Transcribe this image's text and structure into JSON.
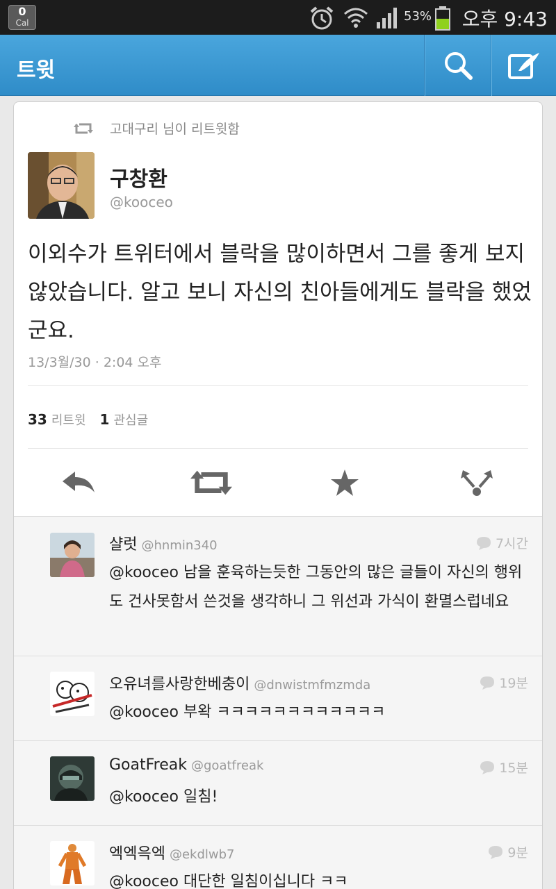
{
  "status_bar": {
    "cal_count": "0",
    "cal_label": "Cal",
    "battery": "53%",
    "time": "오후 9:43"
  },
  "action_bar": {
    "title": "트윗"
  },
  "tweet": {
    "retweeted_by": "고대구리 님이 리트윗함",
    "author_name": "구창환",
    "author_handle": "@kooceo",
    "text": "이외수가 트위터에서 블락을 많이하면서 그를 좋게 보지 않았습니다. 알고 보니 자신의 친아들에게도 블락을 했었군요.",
    "timestamp": "13/3월/30 · 2:04 오후",
    "retweet_count": "33",
    "retweet_label": "리트윗",
    "favorite_count": "1",
    "favorite_label": "관심글"
  },
  "replies": [
    {
      "name": "샬럿",
      "handle": "@hnmin340",
      "time": "7시간",
      "text": "@kooceo 남을 훈육하는듯한 그동안의 많은 글들이 자신의 행위도 건사못함서 쓴것을 생각하니 그 위선과 가식이 환멸스럽네요"
    },
    {
      "name": "오유녀를사랑한베충이",
      "handle": "@dnwistmfmzmda",
      "time": "19분",
      "text": "@kooceo 부왁 ㅋㅋㅋㅋㅋㅋㅋㅋㅋㅋㅋㅋ"
    },
    {
      "name": "GoatFreak",
      "handle": "@goatfreak",
      "time": "15분",
      "text": "@kooceo 일침!"
    },
    {
      "name": "엑엑윽엑",
      "handle": "@ekdlwb7",
      "time": "9분",
      "text": "@kooceo 대단한 일침이십니다 ㅋㅋ"
    }
  ]
}
